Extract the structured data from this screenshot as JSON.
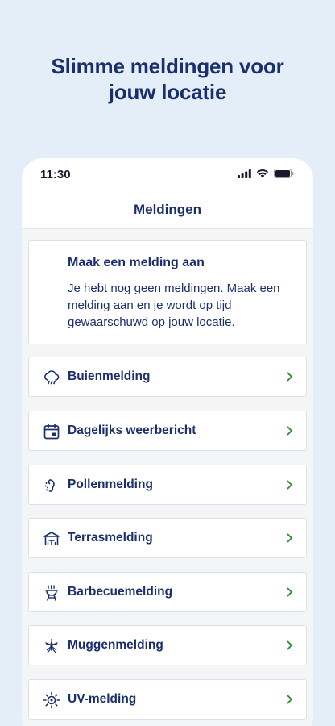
{
  "headline": {
    "line1": "Slimme meldingen voor",
    "line2": "jouw locatie"
  },
  "status_bar": {
    "time": "11:30"
  },
  "navbar": {
    "title": "Meldingen"
  },
  "info_card": {
    "title": "Maak een melding aan",
    "text": "Je hebt nog geen meldingen. Maak een melding aan en je wordt op tijd gewaarschuwd op jouw locatie."
  },
  "notifications": [
    {
      "label": "Buienmelding",
      "icon": "rain-cloud-icon"
    },
    {
      "label": "Dagelijks weerbericht",
      "icon": "calendar-icon"
    },
    {
      "label": "Pollenmelding",
      "icon": "pollen-icon"
    },
    {
      "label": "Terrasmelding",
      "icon": "terrace-icon"
    },
    {
      "label": "Barbecuemelding",
      "icon": "barbecue-icon"
    },
    {
      "label": "Muggenmelding",
      "icon": "mosquito-icon"
    },
    {
      "label": "UV-melding",
      "icon": "sun-icon"
    }
  ],
  "colors": {
    "background": "#e3eef9",
    "text_primary": "#1c2f6d",
    "chevron": "#2e8b2e"
  }
}
